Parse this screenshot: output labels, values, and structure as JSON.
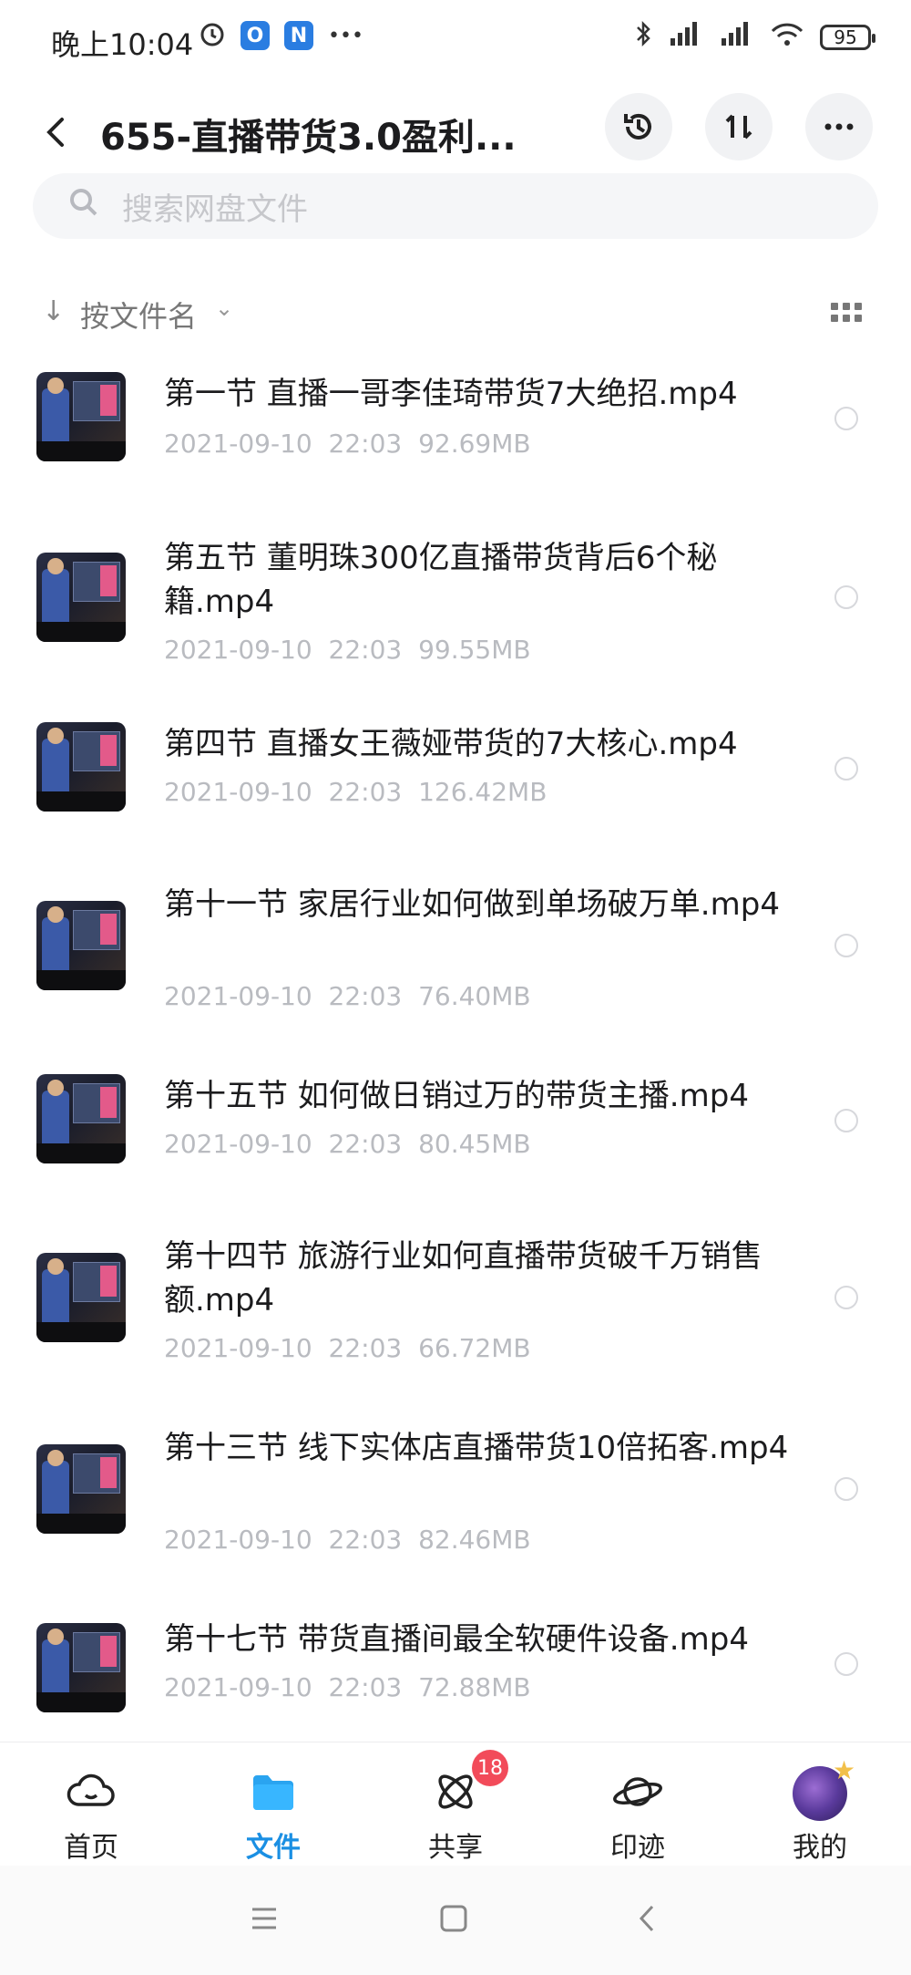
{
  "status": {
    "time": "晚上10:04",
    "battery": "95",
    "app_badge_1": "O",
    "app_badge_2": "N",
    "more": "•••"
  },
  "header": {
    "title": "655-直播带货3.0盈利...",
    "back_icon": "chevron-left-icon",
    "history_icon": "history-icon",
    "sort_icon": "sort-icon",
    "more_icon": "more-icon"
  },
  "search": {
    "placeholder": "搜索网盘文件"
  },
  "sort": {
    "label": "按文件名"
  },
  "files": [
    {
      "name": "第一节 直播一哥李佳琦带货7大绝招.mp4",
      "date": "2021-09-10",
      "time": "22:03",
      "size": "92.69MB"
    },
    {
      "name": "第五节 董明珠300亿直播带货背后6个秘籍.mp4",
      "date": "2021-09-10",
      "time": "22:03",
      "size": "99.55MB"
    },
    {
      "name": "第四节 直播女王薇娅带货的7大核心.mp4",
      "date": "2021-09-10",
      "time": "22:03",
      "size": "126.42MB"
    },
    {
      "name": "第十一节 家居行业如何做到单场破万单.mp4",
      "date": "2021-09-10",
      "time": "22:03",
      "size": "76.40MB"
    },
    {
      "name": "第十五节 如何做日销过万的带货主播.mp4",
      "date": "2021-09-10",
      "time": "22:03",
      "size": "80.45MB"
    },
    {
      "name": "第十四节 旅游行业如何直播带货破千万销售额.mp4",
      "date": "2021-09-10",
      "time": "22:03",
      "size": "66.72MB"
    },
    {
      "name": "第十三节 线下实体店直播带货10倍拓客.mp4",
      "date": "2021-09-10",
      "time": "22:03",
      "size": "82.46MB"
    },
    {
      "name": "第十七节 带货直播间最全软硬件设备.mp4",
      "date": "2021-09-10",
      "time": "22:03",
      "size": "72.88MB"
    }
  ],
  "tabs": [
    {
      "label": "首页",
      "icon": "cloud-home-icon"
    },
    {
      "label": "文件",
      "icon": "folder-icon",
      "active": true
    },
    {
      "label": "共享",
      "icon": "atom-share-icon",
      "badge": "18"
    },
    {
      "label": "印迹",
      "icon": "planet-icon"
    },
    {
      "label": "我的",
      "icon": "avatar"
    }
  ],
  "colors": {
    "accent": "#1a8fe3",
    "badge": "#f24b5a"
  }
}
